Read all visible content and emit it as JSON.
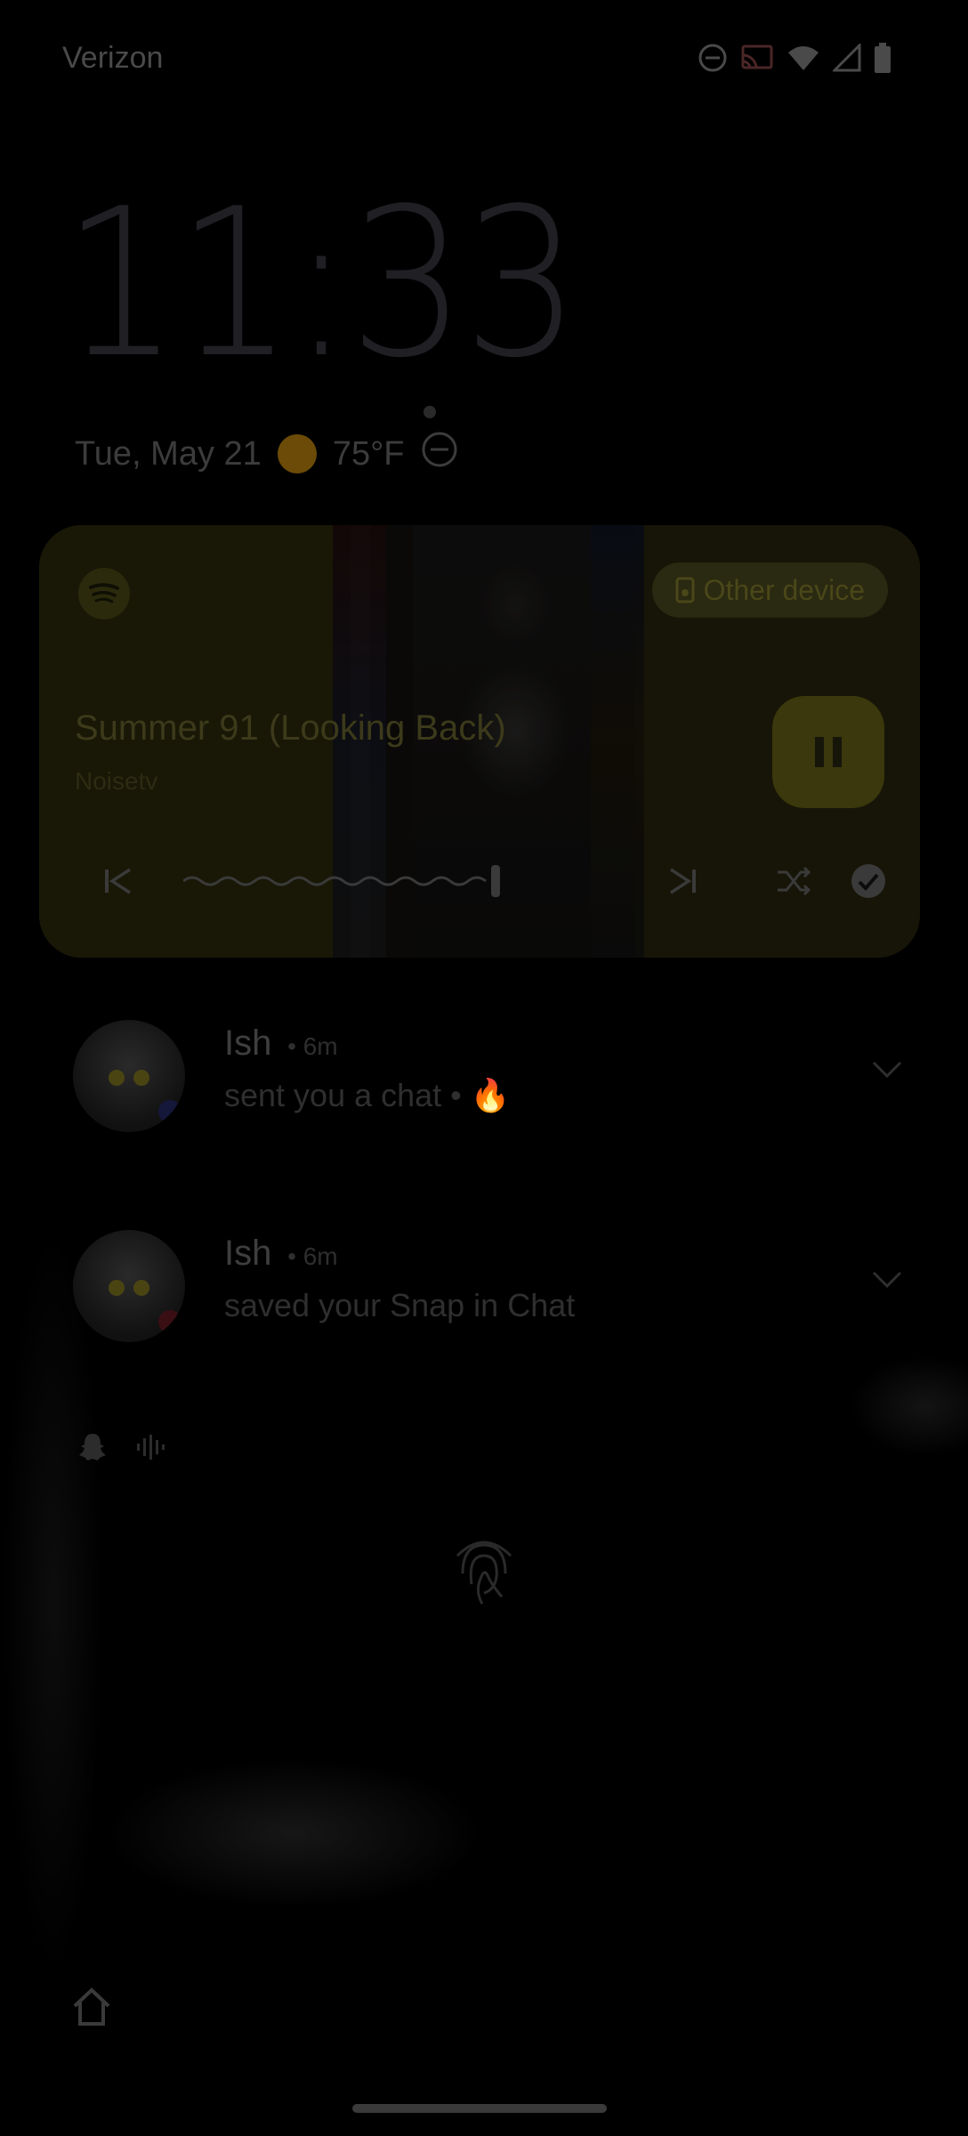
{
  "status_bar": {
    "carrier": "Verizon",
    "icons": [
      "do-not-disturb-icon",
      "cast-icon",
      "wifi-icon",
      "signal-icon",
      "battery-icon"
    ]
  },
  "lockscreen": {
    "time": "11:33",
    "date": "Tue, May 21",
    "weather_icon": "sun-icon",
    "temperature": "75°F"
  },
  "media": {
    "app_icon": "spotify-icon",
    "output_label": "Other device",
    "title": "Summer 91 (Looking Back)",
    "artist": "Noisetv",
    "accent": "#3a380c"
  },
  "notifications": [
    {
      "name": "Ish",
      "time": "6m",
      "text": "sent you a chat • 🔥"
    },
    {
      "name": "Ish",
      "time": "6m",
      "text": "saved your Snap in Chat"
    }
  ]
}
